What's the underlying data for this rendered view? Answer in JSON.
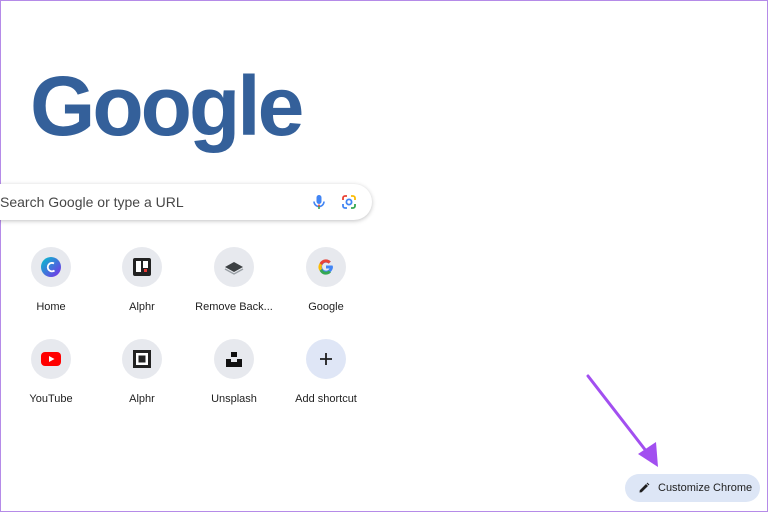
{
  "logo": {
    "text": "Google",
    "color": "#34609a"
  },
  "search": {
    "placeholder": "Search Google or type a URL",
    "mic_icon": "microphone-icon",
    "lens_icon": "google-lens-icon"
  },
  "shortcuts": [
    {
      "label": "Home",
      "icon": "canva-icon"
    },
    {
      "label": "Alphr",
      "icon": "trello-icon"
    },
    {
      "label": "Remove Back...",
      "icon": "layers-icon"
    },
    {
      "label": "Google",
      "icon": "google-g-icon"
    },
    {
      "label": "YouTube",
      "icon": "youtube-icon"
    },
    {
      "label": "Alphr",
      "icon": "square-logo-icon"
    },
    {
      "label": "Unsplash",
      "icon": "unsplash-icon"
    },
    {
      "label": "Add shortcut",
      "icon": "plus-icon"
    }
  ],
  "customize": {
    "label": "Customize Chrome",
    "icon": "pencil-icon"
  },
  "colors": {
    "annotation_arrow": "#a24ff0",
    "customize_bg": "#dde6f6",
    "tile_bg": "#e7e9ee"
  }
}
